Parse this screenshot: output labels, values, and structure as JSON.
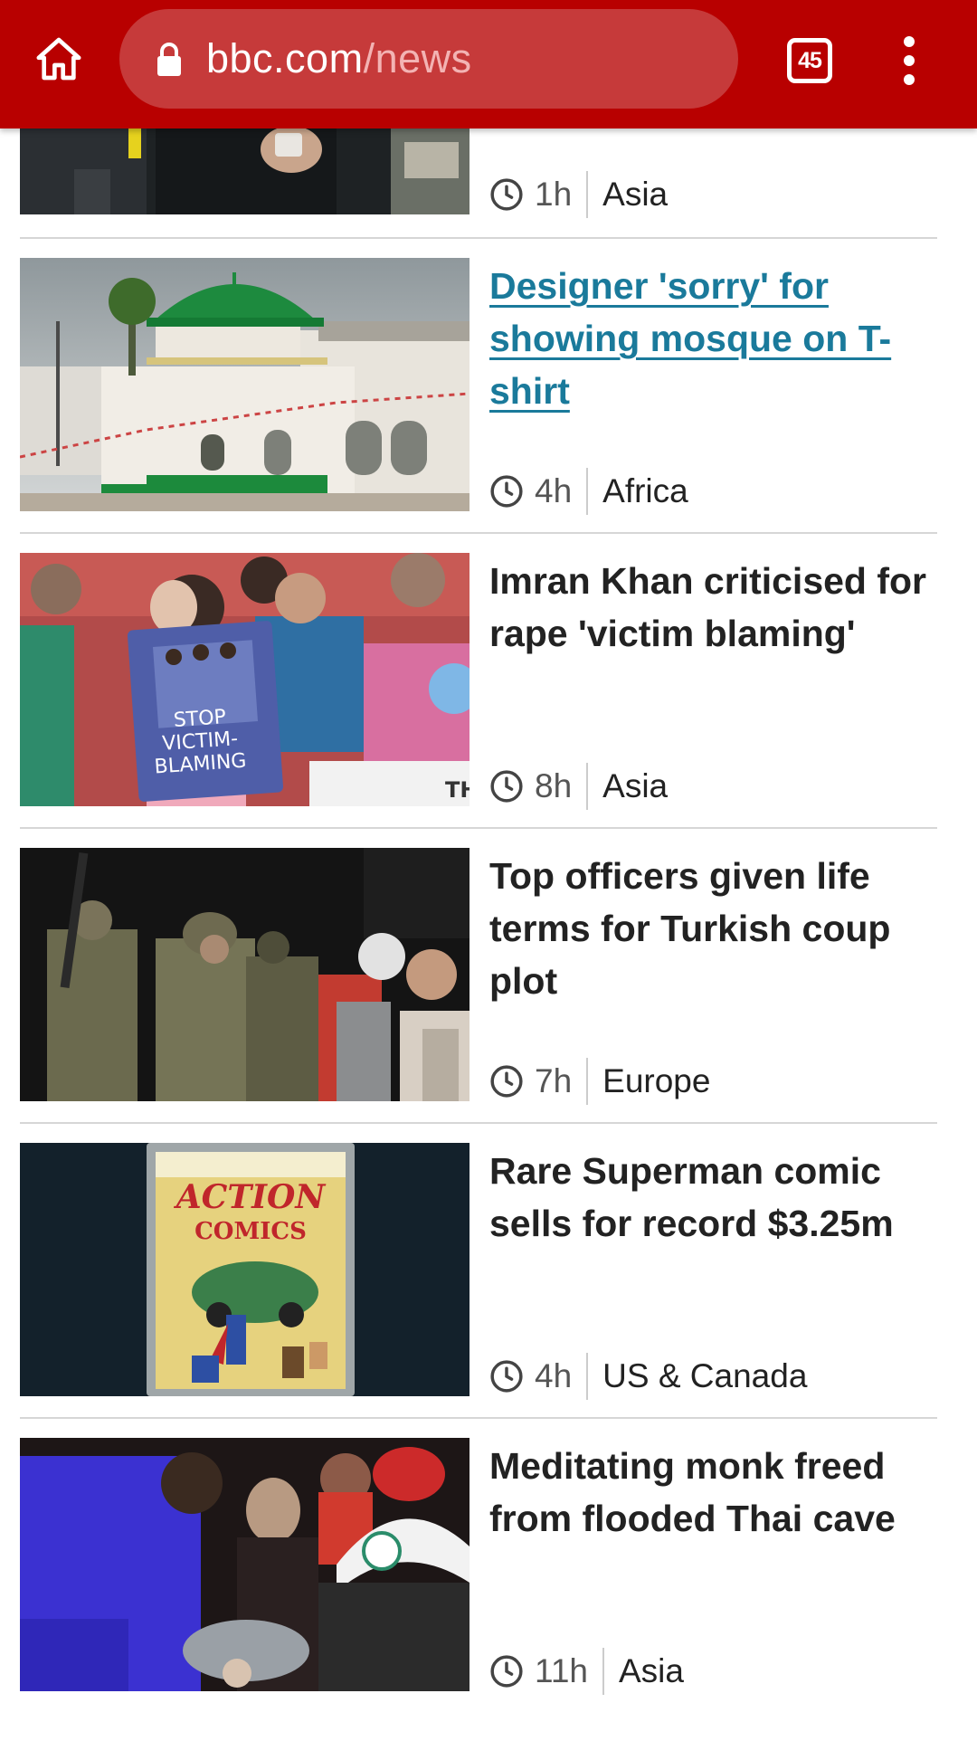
{
  "browser": {
    "url_host": "bbc.com",
    "url_path": "/news",
    "tab_count": "45",
    "icons": {
      "home": "home-icon",
      "lock": "lock-icon",
      "tabs": "tab-switcher-icon",
      "menu": "more-vert-icon"
    },
    "theme_color": "#b80000"
  },
  "stories": [
    {
      "headline": "",
      "time": "1h",
      "section": "Asia",
      "visited": false
    },
    {
      "headline": "Designer 'sorry' for showing mosque on T-shirt",
      "time": "4h",
      "section": "Africa",
      "visited": true
    },
    {
      "headline": "Imran Khan criticised for rape 'victim blaming'",
      "time": "8h",
      "section": "Asia",
      "visited": false
    },
    {
      "headline": "Top officers given life terms for Turkish coup plot",
      "time": "7h",
      "section": "Europe",
      "visited": false
    },
    {
      "headline": "Rare Superman comic sells for record $3.25m",
      "time": "4h",
      "section": "US & Canada",
      "visited": false
    },
    {
      "headline": "Meditating monk freed from flooded Thai cave",
      "time": "11h",
      "section": "Asia",
      "visited": false
    }
  ],
  "sign_text": "STOP VICTIM-BLAMING",
  "comic_text": "ACTION COMICS",
  "colors": {
    "visited_link": "#1a7a9b",
    "headline": "#222222",
    "divider": "#d6d6d6"
  }
}
